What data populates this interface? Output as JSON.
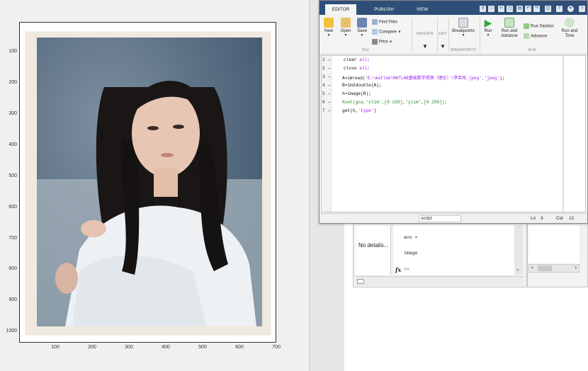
{
  "figure": {
    "y_ticks": [
      "100",
      "200",
      "300",
      "400",
      "500",
      "600",
      "700",
      "800",
      "900",
      "1000"
    ],
    "x_ticks": [
      "100",
      "200",
      "300",
      "400",
      "500",
      "600",
      "700"
    ]
  },
  "editor": {
    "tabs": [
      "EDITOR",
      "PUBLISH",
      "VIEW"
    ],
    "toolstrip": {
      "new": "New",
      "open": "Open",
      "save": "Save",
      "find_files": "Find Files",
      "compare": "Compare",
      "print": "Print",
      "navigate": "NAVIGATE",
      "edit": "EDIT",
      "breakpoints": "Breakpoints",
      "run": "Run",
      "run_advance": "Run and Advance",
      "run_section": "Run Section",
      "advance": "Advance",
      "run_time": "Run and Time",
      "sections": [
        "FILE",
        "BREAKPOINTS",
        "RUN"
      ]
    },
    "code": {
      "line_numbers": [
        "1",
        "2",
        "3",
        "4",
        "5",
        "6",
        "7"
      ],
      "line_markers": [
        "—",
        "—",
        "—",
        "—",
        "—",
        "—",
        "—"
      ],
      "l1_a": "clear ",
      "l1_b": "all;",
      "l2_a": "close ",
      "l2_b": "all;",
      "l3_a": "A=imread(",
      "l3_b": "'E:\\matlab\\MATLAB基础数学视频（理论）\\李若彤.jpeg','jpeg'",
      "l3_c": ");",
      "l4": "B=im2double(A);",
      "l5": "h=image(B);",
      "l6": "%set(gca,'xlim',[0 320],'ylim',[0 256]);",
      "l7_a": "get(h,",
      "l7_b": "'type'",
      "l7_c": ")"
    },
    "status": {
      "mode": "script",
      "ln_label": "Ln",
      "ln_value": "3",
      "col_label": "Col",
      "col_value": "12"
    }
  },
  "command_window": {
    "details": "No details...",
    "line1": "ans =",
    "line2": "image",
    "prompt_icon": "fx",
    "prompt": ">>"
  }
}
